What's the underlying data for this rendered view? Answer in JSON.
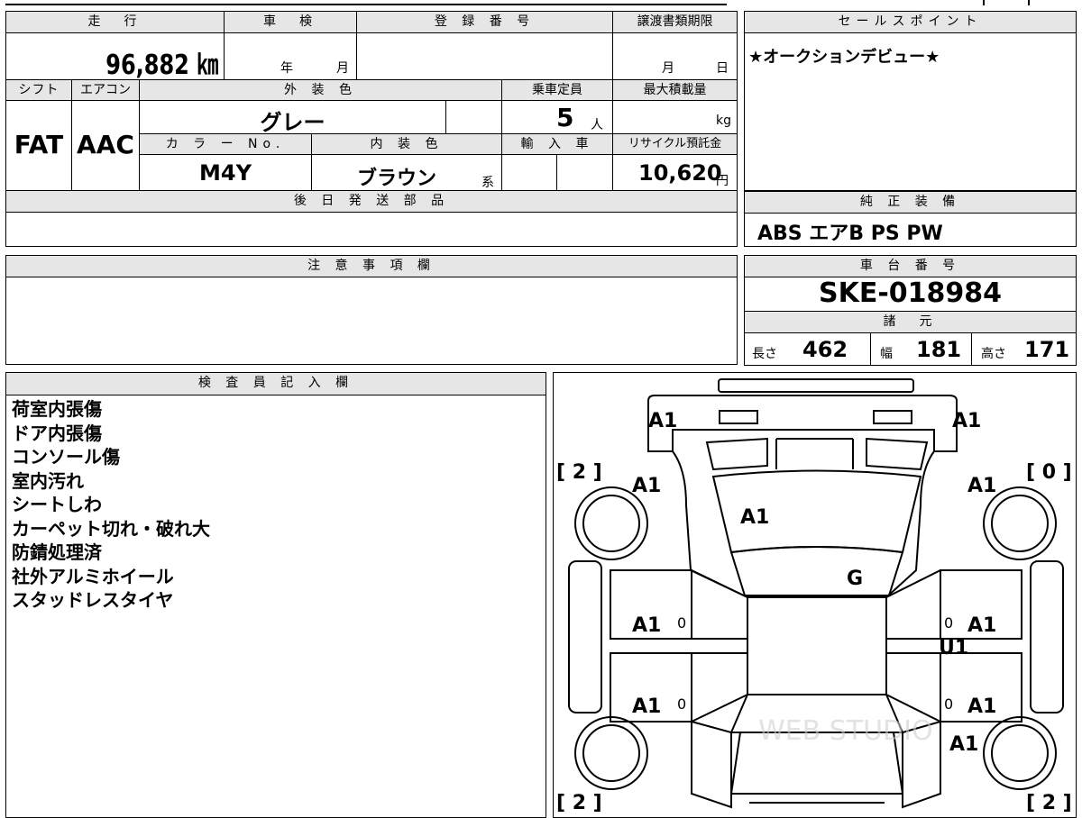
{
  "top": {
    "mileage_label": "走　行",
    "mileage_value": "96,882 ㎞",
    "shaken_label": "車　検",
    "shaken_year_unit": "年",
    "shaken_month_unit": "月",
    "reg_label": "登 録 番 号",
    "transfer_label": "譲渡書類期限",
    "transfer_month_unit": "月",
    "transfer_day_unit": "日",
    "shift_label": "シフト",
    "aircon_label": "エアコン",
    "exterior_label": "外 装 色",
    "capacity_label": "乗車定員",
    "maxload_label": "最大積載量",
    "shift_value": "FAT",
    "aircon_value": "AAC",
    "exterior_value": "グレー",
    "capacity_value": "5",
    "capacity_unit": "人",
    "maxload_unit": "kg",
    "colorno_label": "カ ラ ー No.",
    "interior_label": "内 装 色",
    "import_label": "輸 入 車",
    "recycle_label": "リサイクル預託金",
    "colorno_value": "M4Y",
    "interior_value": "ブラウン",
    "interior_suffix": "系",
    "recycle_value": "10,620",
    "recycle_unit": "円",
    "parts_label": "後 日 発 送 部 品"
  },
  "sales": {
    "label": "セールスポイント",
    "text": "★オークションデビュー★"
  },
  "equipment": {
    "label": "純 正 装 備",
    "value": "ABS エアB PS PW"
  },
  "notes": {
    "label": "注 意 事 項 欄"
  },
  "chassis": {
    "label": "車 台 番 号",
    "value": "SKE-018984",
    "specs_label": "諸　元",
    "length_label": "長さ",
    "length_value": "462",
    "width_label": "幅",
    "width_value": "181",
    "height_label": "高さ",
    "height_value": "171"
  },
  "inspector": {
    "label": "検 査 員 記 入 欄",
    "lines": [
      "荷室内張傷",
      "ドア内張傷",
      "コンソール傷",
      "室内汚れ",
      "シートしわ",
      "カーペット切れ・破れ大",
      "防錆処理済",
      "社外アルミホイール",
      "スタッドレスタイヤ"
    ]
  },
  "diagram": {
    "codes": {
      "rear_left": "A1",
      "rear_right": "A1",
      "tire_rear_left": "[ 2 ]",
      "tire_rear_right": "[ 0 ]",
      "quarter_left": "A1",
      "quarter_right": "A1",
      "rear_glass": "A1",
      "roof": "G",
      "rear_door_left": "A1",
      "rear_door_left_mark": "0",
      "rear_door_right": "A1",
      "rear_door_right_mark": "0",
      "rear_door_right_sub": "U1",
      "front_door_left": "A1",
      "front_door_left_mark": "0",
      "front_door_right": "A1",
      "front_door_right_mark": "0",
      "fender_right": "A1",
      "tire_front_left": "[ 2 ]",
      "tire_front_right": "[ 2 ]"
    },
    "watermark": "WEB STUDIO"
  }
}
